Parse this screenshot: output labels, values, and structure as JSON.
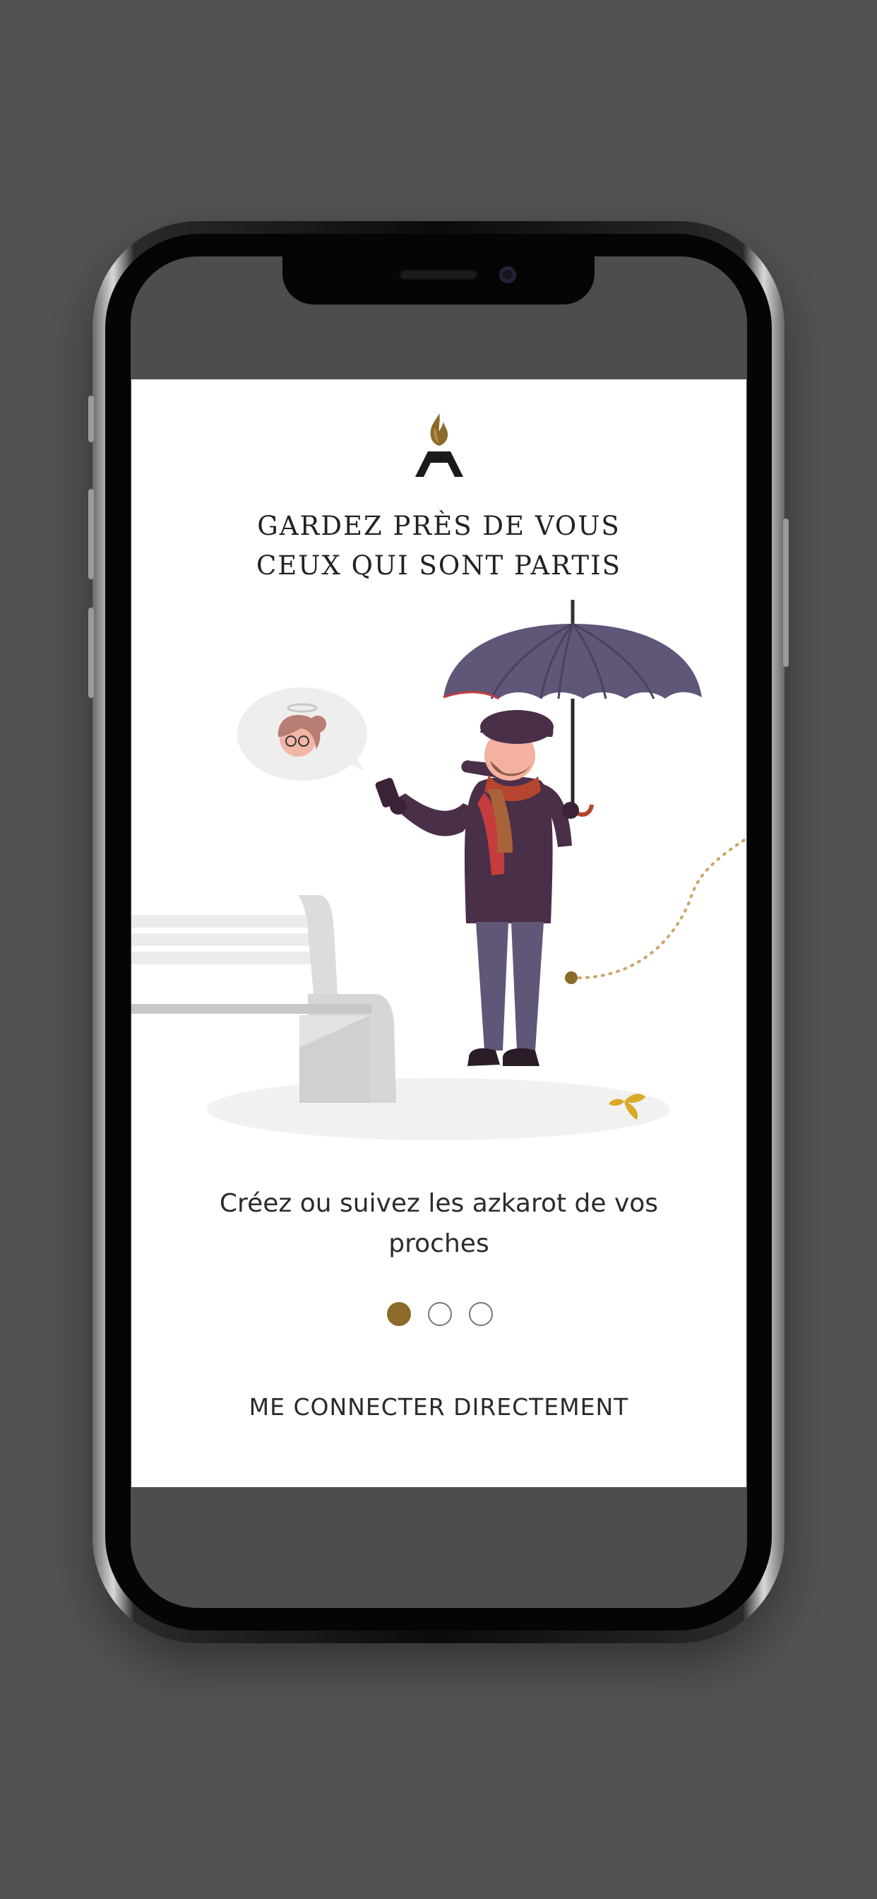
{
  "colors": {
    "accent": "#8b6a2a",
    "background": "#515151",
    "text": "#222222",
    "umbrella": "#5f5678",
    "coat": "#4a2f49"
  },
  "headline": {
    "line1": "GARDEZ PRÈS DE VOUS",
    "line2": "CEUX QUI SONT PARTIS"
  },
  "subtitle": "Créez ou suivez les azkarot de vos proches",
  "pagination": {
    "total": 3,
    "active_index": 0
  },
  "cta_label": "ME CONNECTER DIRECTEMENT",
  "icons": {
    "logo": "flame-a-logo",
    "illustration": "man-with-umbrella-illustration"
  }
}
